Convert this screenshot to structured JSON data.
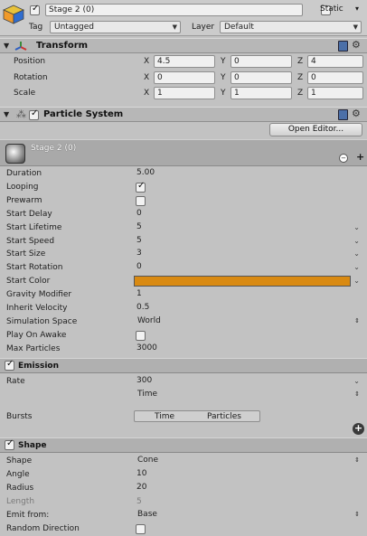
{
  "header": {
    "active": true,
    "object_name": "Stage 2 (0)",
    "static_label": "Static",
    "tag_label": "Tag",
    "tag_value": "Untagged",
    "layer_label": "Layer",
    "layer_value": "Default"
  },
  "transform": {
    "title": "Transform",
    "rows": [
      {
        "label": "Position",
        "x": "4.5",
        "y": "0",
        "z": "4"
      },
      {
        "label": "Rotation",
        "x": "0",
        "y": "0",
        "z": "0"
      },
      {
        "label": "Scale",
        "x": "1",
        "y": "1",
        "z": "1"
      }
    ],
    "axis": {
      "x": "X",
      "y": "Y",
      "z": "Z"
    }
  },
  "particle_system": {
    "title": "Particle System",
    "open_editor_label": "Open Editor...",
    "sub_name": "Stage 2 (0)",
    "main_rows": [
      {
        "label": "Duration",
        "value": "5.00",
        "kind": "text"
      },
      {
        "label": "Looping",
        "value": "",
        "kind": "check-on"
      },
      {
        "label": "Prewarm",
        "value": "",
        "kind": "check-off"
      },
      {
        "label": "Start Delay",
        "value": "0",
        "kind": "text"
      },
      {
        "label": "Start Lifetime",
        "value": "5",
        "kind": "curve"
      },
      {
        "label": "Start Speed",
        "value": "5",
        "kind": "curve"
      },
      {
        "label": "Start Size",
        "value": "3",
        "kind": "curve"
      },
      {
        "label": "Start Rotation",
        "value": "0",
        "kind": "curve"
      },
      {
        "label": "Start Color",
        "value": "",
        "kind": "color"
      },
      {
        "label": "Gravity Modifier",
        "value": "1",
        "kind": "text"
      },
      {
        "label": "Inherit Velocity",
        "value": "0.5",
        "kind": "text"
      },
      {
        "label": "Simulation Space",
        "value": "World",
        "kind": "dropdown"
      },
      {
        "label": "Play On Awake",
        "value": "",
        "kind": "check-off"
      },
      {
        "label": "Max Particles",
        "value": "3000",
        "kind": "text"
      }
    ],
    "start_color": "#d98a12"
  },
  "emission": {
    "title": "Emission",
    "rate_label": "Rate",
    "rate_value": "300",
    "rate_mode": "Time",
    "bursts_label": "Bursts",
    "bursts_col_time": "Time",
    "bursts_col_particles": "Particles"
  },
  "shape": {
    "title": "Shape",
    "rows": [
      {
        "label": "Shape",
        "value": "Cone",
        "kind": "dropdown",
        "dim": false
      },
      {
        "label": "Angle",
        "value": "10",
        "kind": "text",
        "dim": false
      },
      {
        "label": "Radius",
        "value": "20",
        "kind": "text",
        "dim": false
      },
      {
        "label": "Length",
        "value": "5",
        "kind": "plain",
        "dim": true
      },
      {
        "label": "Emit from:",
        "value": "Base",
        "kind": "dropdown",
        "dim": false
      },
      {
        "label": "Random Direction",
        "value": "",
        "kind": "check-off",
        "dim": false
      }
    ]
  },
  "colors": {
    "accent_book": "#4b6fa8",
    "panel": "#c2c2c2"
  }
}
